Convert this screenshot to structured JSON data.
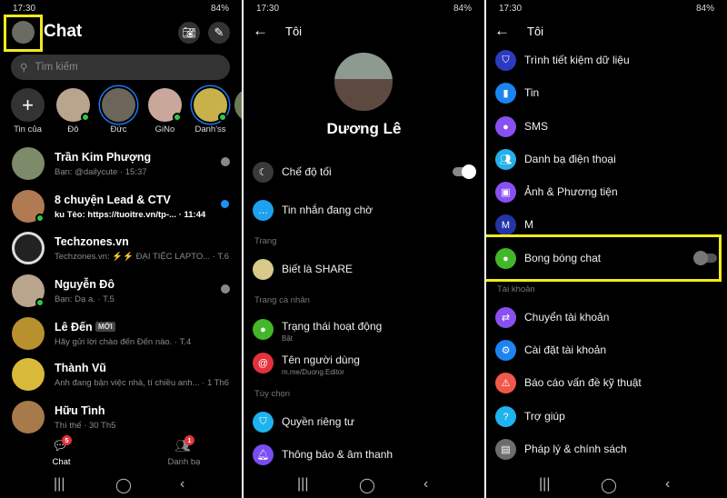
{
  "status": {
    "time": "17:30",
    "battery": "84%"
  },
  "chat_screen": {
    "title": "Chat",
    "search_placeholder": "Tìm kiếm",
    "stories": [
      {
        "label": "Tin của",
        "kind": "add",
        "online": false,
        "ring": false
      },
      {
        "label": "Đô",
        "online": true,
        "ring": false,
        "color": "#b9a48e"
      },
      {
        "label": "Đức",
        "online": false,
        "ring": true,
        "color": "#6c665a"
      },
      {
        "label": "GiNo",
        "online": true,
        "ring": false,
        "color": "#c9a89b"
      },
      {
        "label": "Danh'ss",
        "online": true,
        "ring": true,
        "color": "#c9b14a"
      },
      {
        "label": "Kh",
        "online": false,
        "ring": false,
        "color": "#6d7a57"
      }
    ],
    "conversations": [
      {
        "name": "Trần Kim Phượng",
        "preview": "Bạn: @dailycute · 15:37",
        "unread": false,
        "online": false,
        "color": "#7d8b6a",
        "indicator": "seen"
      },
      {
        "name": "8 chuyện Lead & CTV",
        "preview": "ku Tèo: https://tuoitre.vn/tp-... · 11:44",
        "unread": true,
        "online": true,
        "color": "#b07a52",
        "indicator": "unread-dot"
      },
      {
        "name": "Techzones.vn",
        "preview": "Techzones.vn: ⚡⚡ ĐẠI TIỆC LAPTO... · T.6",
        "unread": false,
        "online": false,
        "color": "#222",
        "indicator": "none"
      },
      {
        "name": "Nguyễn Đô",
        "preview": "Bạn: Dạ a. · T.5",
        "unread": false,
        "online": true,
        "color": "#b9a48e",
        "indicator": "seen"
      },
      {
        "name": "Lê Đến",
        "badge": "MỚI",
        "preview": "Hãy gửi lời chào đến Đến nào. · T.4",
        "unread": false,
        "online": false,
        "color": "#b8902e",
        "indicator": "none"
      },
      {
        "name": "Thành Vũ",
        "preview": "Anh đang bận việc nhà, tí chiều anh... · 1 Th6",
        "unread": false,
        "online": false,
        "color": "#d8b93a",
        "indicator": "none"
      },
      {
        "name": "Hữu Tình",
        "preview": "Thì thế · 30 Th5",
        "unread": false,
        "online": false,
        "color": "#a67a4a",
        "indicator": "none"
      }
    ],
    "bottom_nav": [
      {
        "label": "Chat",
        "badge": "5",
        "active": true
      },
      {
        "label": "Danh bạ",
        "badge": "1",
        "active": false
      }
    ]
  },
  "profile_screen": {
    "title": "Tôi",
    "user_name": "Dương Lê",
    "rows": [
      {
        "type": "item",
        "label": "Chế độ tối",
        "icon": "moon-icon",
        "color": "#3a3a3a",
        "toggle": true,
        "toggle_on": true
      },
      {
        "type": "item",
        "label": "Tin nhắn đang chờ",
        "icon": "chat-bubble-icon",
        "color": "#1ea1f1"
      },
      {
        "type": "section",
        "label": "Trang"
      },
      {
        "type": "item",
        "label": "Biết là SHARE",
        "icon": "page-avatar-icon",
        "color": "#d8c98a"
      },
      {
        "type": "section",
        "label": "Trang cá nhân"
      },
      {
        "type": "item",
        "label": "Trạng thái hoạt động",
        "sub": "Bật",
        "icon": "active-status-icon",
        "color": "#42b72a"
      },
      {
        "type": "item",
        "label": "Tên người dùng",
        "sub": "m.me/Duong.Editor",
        "icon": "at-icon",
        "color": "#e4323c"
      },
      {
        "type": "section",
        "label": "Tùy chọn"
      },
      {
        "type": "item",
        "label": "Quyền riêng tư",
        "icon": "shield-icon",
        "color": "#1eb3ef"
      },
      {
        "type": "item",
        "label": "Thông báo & âm thanh",
        "icon": "bell-icon",
        "color": "#7a4df0"
      }
    ]
  },
  "settings_screen": {
    "title": "Tôi",
    "rows": [
      {
        "type": "item",
        "label": "Trình tiết kiệm dữ liệu",
        "icon": "data-saver-icon",
        "color": "#2b3bbf"
      },
      {
        "type": "item",
        "label": "Tin",
        "icon": "stories-icon",
        "color": "#1c84f0"
      },
      {
        "type": "item",
        "label": "SMS",
        "icon": "sms-icon",
        "color": "#8a4ff0"
      },
      {
        "type": "item",
        "label": "Danh bạ điện thoại",
        "icon": "contacts-icon",
        "color": "#24b0ea"
      },
      {
        "type": "item",
        "label": "Ảnh & Phương tiện",
        "icon": "photo-icon",
        "color": "#8a4ff0"
      },
      {
        "type": "item",
        "label": "M",
        "icon": "m-icon",
        "color": "#2334a8"
      },
      {
        "type": "item",
        "label": "Bong bóng chat",
        "icon": "chat-heads-icon",
        "color": "#42b72a",
        "toggle": true,
        "toggle_on": false,
        "highlighted": true
      },
      {
        "type": "section",
        "label": "Tài khoản"
      },
      {
        "type": "item",
        "label": "Chuyển tài khoản",
        "icon": "switch-account-icon",
        "color": "#8a4ff0"
      },
      {
        "type": "item",
        "label": "Cài đặt tài khoản",
        "icon": "gear-icon",
        "color": "#1c84f0"
      },
      {
        "type": "item",
        "label": "Báo cáo vấn đề kỹ thuật",
        "icon": "warning-icon",
        "color": "#f0584a"
      },
      {
        "type": "item",
        "label": "Trợ giúp",
        "icon": "help-icon",
        "color": "#1eb3ef"
      },
      {
        "type": "item",
        "label": "Pháp lý & chính sách",
        "icon": "document-icon",
        "color": "#6d6d6d"
      }
    ]
  },
  "highlight_color": "#f2ea1a"
}
